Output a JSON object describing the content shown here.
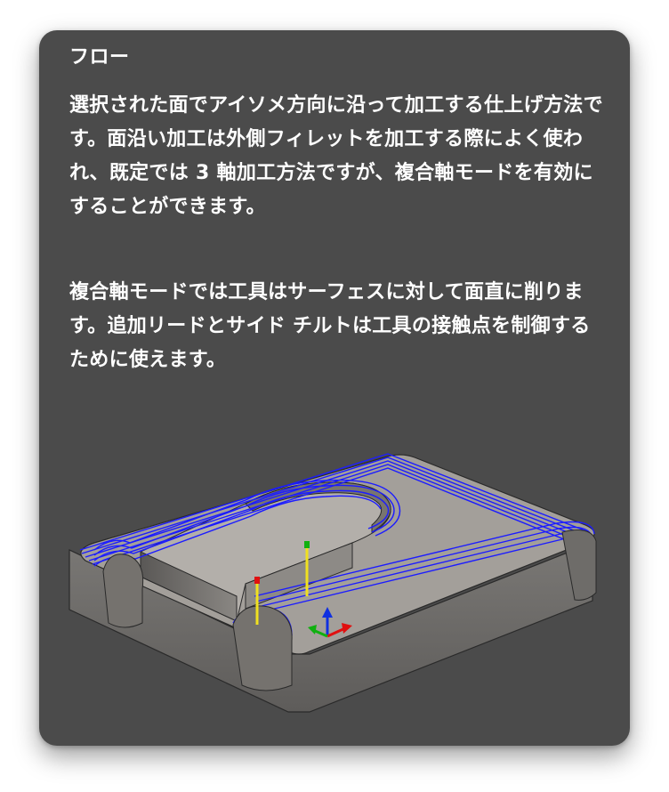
{
  "tooltip": {
    "title": "フロー",
    "paragraphs": [
      "選択された面でアイソメ方向に沿って加工する仕上げ方法です。面沿い加工は外側フィレットを加工する際によく使われ、既定では 3 軸加工方法ですが、複合軸モードを有効にすることができます。",
      "複合軸モードでは工具はサーフェスに対して面直に削ります。追加リードとサイド チルトは工具の接触点を制御するために使えます。"
    ],
    "illustration": {
      "subject": "flow-toolpath-on-u-slot-part",
      "colors": {
        "background": "#4b4b4b",
        "part_top": "#a39f9a",
        "part_side": "#6e6c69",
        "toolpath": "#1c1cff",
        "axis_x": "#e01010",
        "axis_y": "#10b010",
        "axis_z": "#1030e0",
        "tool_marker": "#f0e020"
      }
    }
  }
}
